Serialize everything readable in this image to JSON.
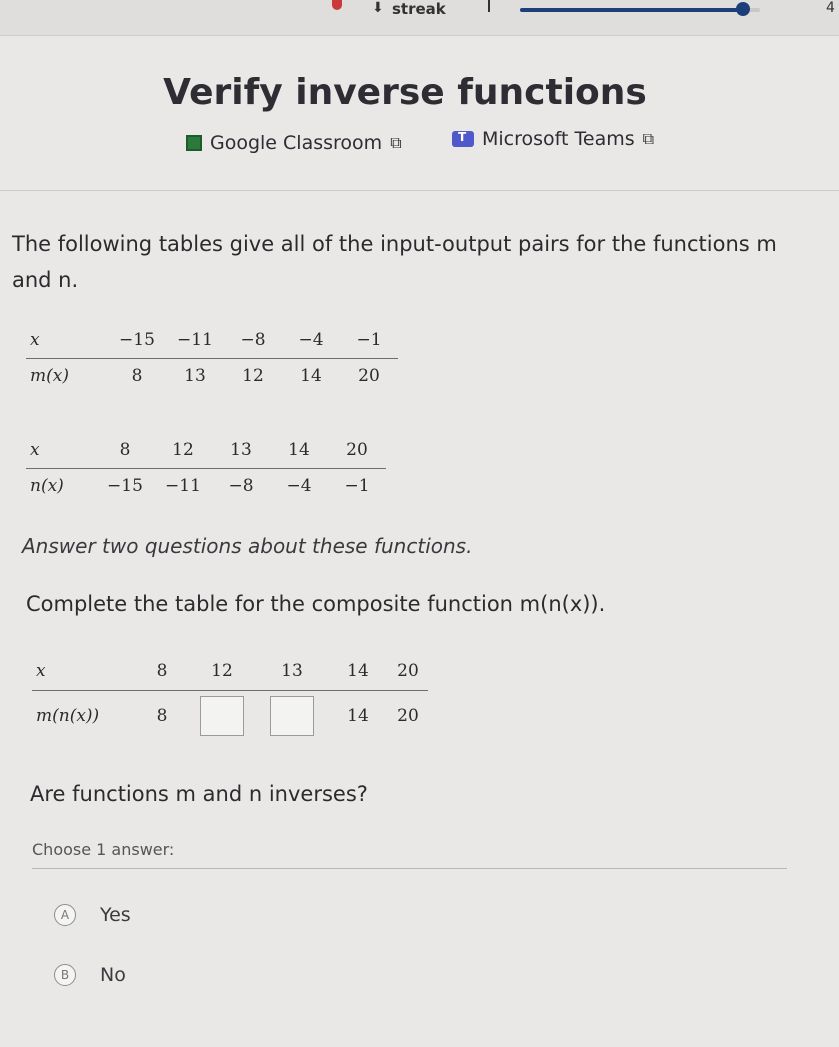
{
  "topbar": {
    "streak_label": "streak",
    "level_number": "4",
    "progress_fraction": 0.93,
    "colors": {
      "progress": "#1c3f7a"
    }
  },
  "page": {
    "title": "Verify inverse functions",
    "share": {
      "google_classroom": "Google Classroom",
      "microsoft_teams": "Microsoft Teams"
    }
  },
  "problem": {
    "intro": "The following tables give all of the input-output pairs for the functions m and n.",
    "table_m": {
      "row_labels": [
        "x",
        "m(x)"
      ],
      "x": [
        "−15",
        "−11",
        "−8",
        "−4",
        "−1"
      ],
      "y": [
        "8",
        "13",
        "12",
        "14",
        "20"
      ]
    },
    "table_n": {
      "row_labels": [
        "x",
        "n(x)"
      ],
      "x": [
        "8",
        "12",
        "13",
        "14",
        "20"
      ],
      "y": [
        "−15",
        "−11",
        "−8",
        "−4",
        "−1"
      ]
    },
    "instruction": "Answer two questions about these functions.",
    "question1": "Complete the table for the composite function m(n(x)).",
    "table_mn": {
      "row_labels": [
        "x",
        "m(n(x))"
      ],
      "x": [
        "8",
        "12",
        "13",
        "14",
        "20"
      ],
      "y": [
        "8",
        "",
        "",
        "14",
        "20"
      ]
    },
    "question2": "Are functions m and n inverses?",
    "choose_label": "Choose 1 answer:",
    "choices": [
      {
        "letter": "A",
        "label": "Yes"
      },
      {
        "letter": "B",
        "label": "No"
      }
    ]
  }
}
